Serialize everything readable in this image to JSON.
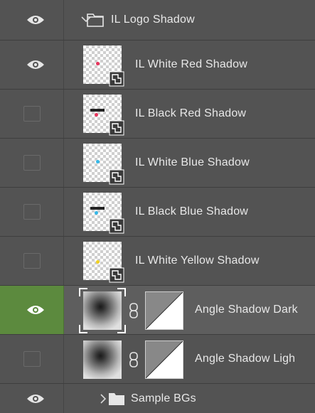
{
  "layers": [
    {
      "name": "IL Logo Shadow",
      "type": "group",
      "expanded": true,
      "visible": true
    },
    {
      "name": "IL White Red Shadow",
      "type": "smart-object",
      "visible": true,
      "accent": "#e8345c",
      "bg": "light"
    },
    {
      "name": "IL Black Red Shadow",
      "type": "smart-object",
      "visible": false,
      "accent": "#e8345c",
      "bg": "dark"
    },
    {
      "name": "IL White Blue Shadow",
      "type": "smart-object",
      "visible": false,
      "accent": "#34b8e8",
      "bg": "light"
    },
    {
      "name": "IL Black Blue Shadow",
      "type": "smart-object",
      "visible": false,
      "accent": "#34b8e8",
      "bg": "dark"
    },
    {
      "name": "IL White Yellow Shadow",
      "type": "smart-object",
      "visible": false,
      "accent": "#f0d020",
      "bg": "light"
    },
    {
      "name": "Angle Shadow Dark",
      "type": "masked-layer",
      "visible": true,
      "selected": true
    },
    {
      "name": "Angle Shadow Ligh",
      "type": "masked-layer",
      "visible": false
    },
    {
      "name": "Sample BGs",
      "type": "group",
      "expanded": false,
      "visible": true
    }
  ],
  "colors": {
    "panel": "#535353",
    "selected_visibility": "#5c8a3e",
    "text": "#e8e8e8"
  },
  "icons": {
    "visibility": "eye-icon",
    "group_open": "chevron-down-icon",
    "group_closed": "chevron-right-icon",
    "folder": "folder-icon",
    "smart_object": "smart-object-badge-icon",
    "mask_link": "chain-link-icon"
  }
}
